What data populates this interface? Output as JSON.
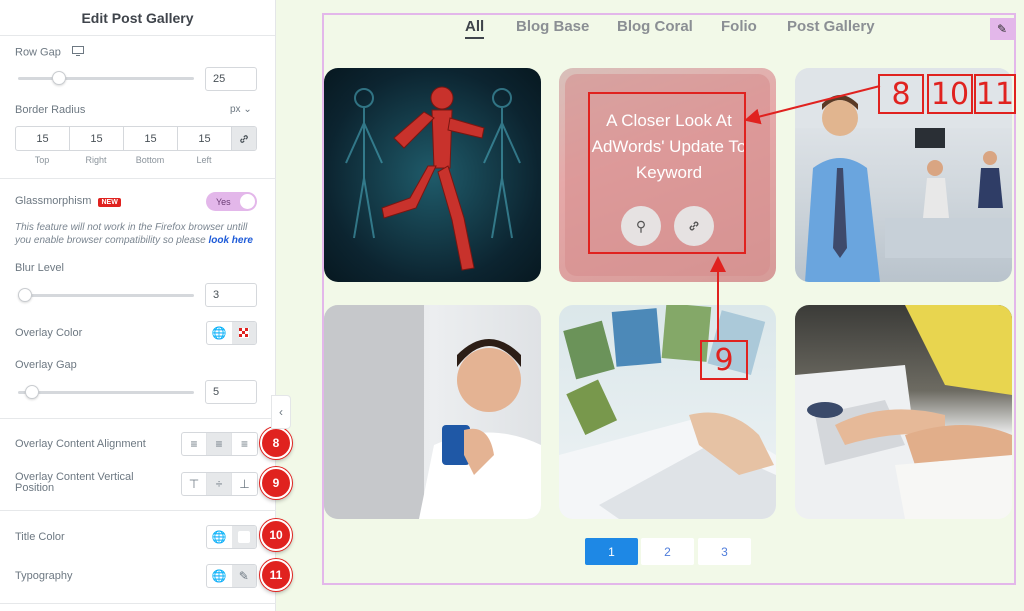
{
  "panel": {
    "title": "Edit Post Gallery",
    "row_gap": {
      "label": "Row Gap",
      "value": "25",
      "level": 0.22
    },
    "border_radius": {
      "label": "Border Radius",
      "unit": "px",
      "values": [
        "15",
        "15",
        "15",
        "15"
      ],
      "sides": [
        "Top",
        "Right",
        "Bottom",
        "Left"
      ]
    },
    "glassmorphism": {
      "label": "Glassmorphism",
      "badge": "NEW",
      "toggle": "Yes",
      "note_a": "This feature will not work in the Firefox browser untill you enable browser compatibility so please",
      "note_link": "look here"
    },
    "blur_level": {
      "label": "Blur Level",
      "value": "3",
      "level": 0.03
    },
    "overlay_color": {
      "label": "Overlay Color"
    },
    "overlay_gap": {
      "label": "Overlay Gap",
      "value": "5",
      "level": 0.08
    },
    "content_alignment": {
      "label": "Overlay Content Alignment",
      "marker": "8"
    },
    "vertical_position": {
      "label": "Overlay Content Vertical Position",
      "marker": "9"
    },
    "title_color": {
      "label": "Title Color",
      "marker": "10"
    },
    "typography": {
      "label": "Typography",
      "marker": "11"
    }
  },
  "gallery": {
    "filters": [
      "All",
      "Blog Base",
      "Blog Coral",
      "Folio",
      "Post Gallery"
    ],
    "hover_card_title": "A Closer Look At AdWords' Update To Keyword",
    "pages": [
      "1",
      "2",
      "3"
    ],
    "annotations": [
      "8",
      "10",
      "11",
      "9"
    ]
  },
  "colors": {
    "accent_pink": "#e3b7ea",
    "marker_red": "#e0221f",
    "pagination_blue": "#1e88e5",
    "canvas_bg": "#f2f9e8"
  },
  "icons": [
    "desktop-icon",
    "link-icon",
    "globe-icon",
    "checker-icon",
    "pencil-icon",
    "search-icon",
    "chevron-left-icon",
    "align-left-icon",
    "align-center-icon",
    "align-right-icon",
    "valign-top-icon",
    "valign-middle-icon",
    "valign-bottom-icon"
  ]
}
